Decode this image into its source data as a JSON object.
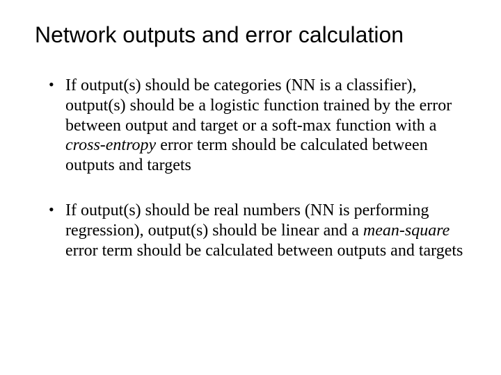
{
  "title": "Network outputs and error calculation",
  "bullets": [
    {
      "pre": "If output(s) should be categories (NN is a classifier), output(s) should be a logistic function trained by the error between output and target or a soft-max function with a ",
      "em": "cross-entropy",
      "post": " error term should be calculated between outputs and targets"
    },
    {
      "pre": "If output(s) should be real numbers (NN is performing regression), output(s) should be linear and a ",
      "em": "mean-square",
      "post": " error term should be calculated between outputs and targets"
    }
  ]
}
